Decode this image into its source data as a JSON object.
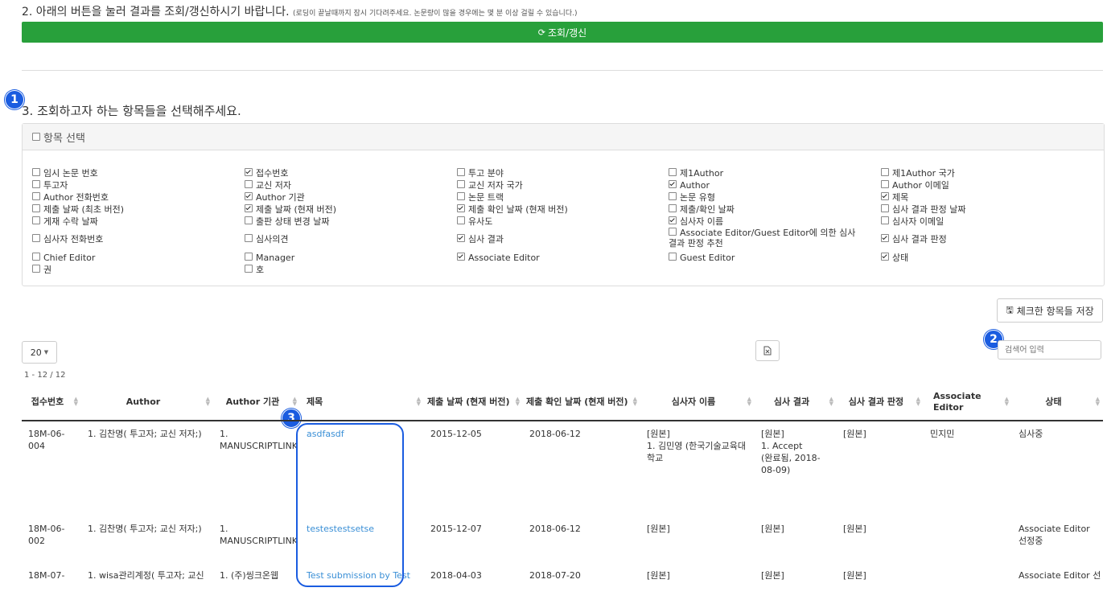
{
  "step2": {
    "title": "2. 아래의 버튼을 눌러 결과를 조회/갱신하시기 바랍니다.",
    "note": "(로딩이 끝날때까지 잠시 기다려주세요. 논문량이 많을 경우에는 몇 분 이상 걸릴 수 있습니다.)",
    "button_label": "조회/갱신",
    "button_color": "#28a03b"
  },
  "markers": [
    "1",
    "2",
    "3"
  ],
  "step3": {
    "title": "3. 조회하고자 하는 항목들을 선택해주세요.",
    "panel_title": "항목 선택",
    "options": [
      {
        "label": "임시 논문 번호",
        "checked": false
      },
      {
        "label": "접수번호",
        "checked": true
      },
      {
        "label": "투고 분야",
        "checked": false
      },
      {
        "label": "제1Author",
        "checked": false
      },
      {
        "label": "제1Author 국가",
        "checked": false
      },
      {
        "label": "투고자",
        "checked": false
      },
      {
        "label": "교신 저자",
        "checked": false
      },
      {
        "label": "교신 저자 국가",
        "checked": false
      },
      {
        "label": "Author",
        "checked": true
      },
      {
        "label": "Author 이메일",
        "checked": false
      },
      {
        "label": "Author 전화번호",
        "checked": false
      },
      {
        "label": "Author 기관",
        "checked": true
      },
      {
        "label": "논문 트랙",
        "checked": false
      },
      {
        "label": "논문 유형",
        "checked": false
      },
      {
        "label": "제목",
        "checked": true
      },
      {
        "label": "제출 날짜 (최초 버전)",
        "checked": false
      },
      {
        "label": "제출 날짜 (현재 버전)",
        "checked": true
      },
      {
        "label": "제출 확인 날짜 (현재 버전)",
        "checked": true
      },
      {
        "label": "제출/확인 날짜",
        "checked": false
      },
      {
        "label": "심사 결과 판정 날짜",
        "checked": false
      },
      {
        "label": "게재 수락 날짜",
        "checked": false
      },
      {
        "label": "출판 상태 변경 날짜",
        "checked": false
      },
      {
        "label": "유사도",
        "checked": false
      },
      {
        "label": "심사자 이름",
        "checked": true
      },
      {
        "label": "심사자 이메일",
        "checked": false
      },
      {
        "label": "심사자 전화번호",
        "checked": false
      },
      {
        "label": "심사의견",
        "checked": false
      },
      {
        "label": "심사 결과",
        "checked": true
      },
      {
        "label": "Associate Editor/Guest Editor에 의한 심사 결과 판정 추천",
        "checked": false
      },
      {
        "label": "심사 결과 판정",
        "checked": true
      },
      {
        "label": "Chief Editor",
        "checked": false
      },
      {
        "label": "Manager",
        "checked": false
      },
      {
        "label": "Associate Editor",
        "checked": true
      },
      {
        "label": "Guest Editor",
        "checked": false
      },
      {
        "label": "상태",
        "checked": true
      },
      {
        "label": "권",
        "checked": false
      },
      {
        "label": "호",
        "checked": false
      }
    ],
    "save_label": "체크한 항목들 저장"
  },
  "table_controls": {
    "page_size": "20",
    "search_placeholder": "검색어 입력",
    "range_text": "1 - 12 / 12"
  },
  "table": {
    "headers": [
      "접수번호",
      "Author",
      "Author 기관",
      "제목",
      "제출 날짜 (현재 버전)",
      "제출 확인 날짜 (현재 버전)",
      "심사자 이름",
      "심사 결과",
      "심사 결과 판정",
      "Associate Editor",
      "상태"
    ],
    "rows": [
      {
        "no": "18M-06-004",
        "author": "1. 김찬명( 투고자; 교신 저자;)",
        "affiliation": "1. MANUSCRIPTLINK",
        "title": "asdfasdf",
        "submitted": "2015-12-05",
        "confirmed": "2018-06-12",
        "reviewer_a": "[원본]",
        "reviewer_b": "1. 김민영 (한국기술교육대학교",
        "result_a": "[원본]",
        "result_b": "1. Accept",
        "result_c": "(완료됨, 2018-08-09)",
        "decision": "[원본]",
        "ae": "민지민",
        "status": "심사중"
      },
      {
        "no": "18M-06-002",
        "author": "1. 김찬명( 투고자; 교신 저자;)",
        "affiliation": "1. MANUSCRIPTLINK",
        "title": "testestestsetse",
        "submitted": "2015-12-07",
        "confirmed": "2018-06-12",
        "reviewer_a": "[원본]",
        "result_a": "[원본]",
        "decision": "[원본]",
        "ae": "",
        "status": "Associate Editor 선정중"
      },
      {
        "no": "18M-07-",
        "author": "1. wisa관리계정( 투고자; 교신",
        "affiliation": "1. (주)씽크온웹",
        "title": "Test submission by Test",
        "submitted": "2018-04-03",
        "confirmed": "2018-07-20",
        "reviewer_a": "[원본]",
        "result_a": "[원본]",
        "decision": "[원본]",
        "ae": "",
        "status": "Associate Editor 선"
      }
    ]
  }
}
